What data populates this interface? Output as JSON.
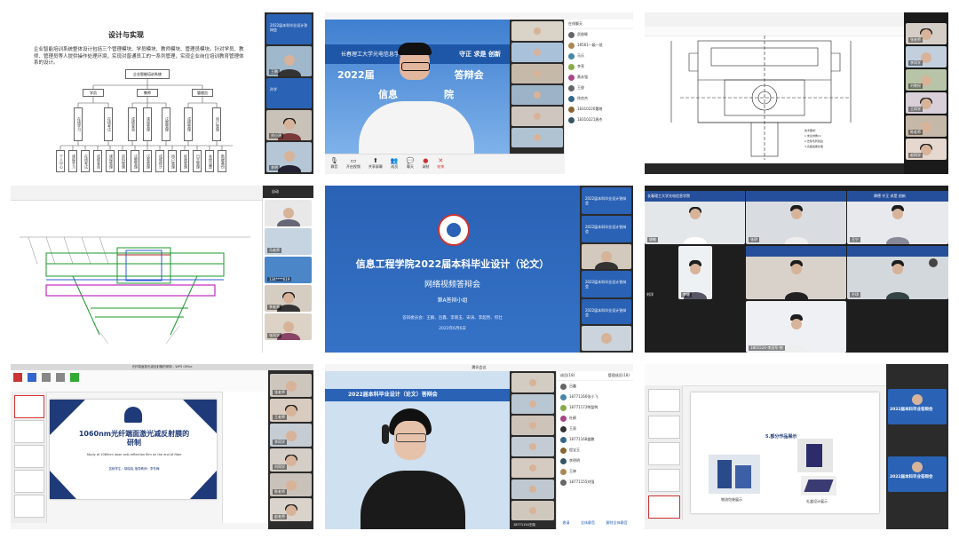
{
  "tile1": {
    "slide_title": "设计与实现",
    "slide_text": "企业智能培训系统整体设计包括三个管理模块、学员模块、教师模块、管理员模块。针对学员、教师、管理员等人提供操作处理环境，实现对普通员工的一系列管理，实现企业岗位培训教育管理体系的设计。",
    "root": "企业智能培训系统",
    "modules": [
      "学员",
      "教师",
      "管理员"
    ],
    "subs": [
      "在线学习",
      "在线考试",
      "成绩查询",
      "课程管理",
      "试题管理",
      "成绩管理",
      "用户管理",
      "系统维护"
    ],
    "leaves": [
      "个人中心",
      "课程学习",
      "在线考试",
      "成绩查询",
      "课程管理",
      "资料管理",
      "试题管理",
      "试卷管理",
      "成绩统计",
      "用户管理",
      "权限管理",
      "日志管理",
      "系统设置",
      "数据备份"
    ],
    "participants": [
      "2022届本科毕业设计答辩会",
      "王鹏",
      "孙学",
      "刘小涵",
      "李明",
      "张伟"
    ]
  },
  "tile2": {
    "banner_text": "守正 求是 创新",
    "school": "长春理工大学光电信息学院",
    "title": "2022届",
    "title_suffix": "答辩会",
    "sub": "信息",
    "sub_tail": "院",
    "chat_header": "在线聊天",
    "chat_items": [
      "武俊辉",
      "18561一级一班",
      "马乐",
      "李亮",
      "黄永强",
      "王俊",
      "徐良杰",
      "18310226董晓",
      "18310221周杰"
    ],
    "toolbar": [
      "静音",
      "开启视频",
      "共享屏幕",
      "成员",
      "聊天",
      "录制",
      "结束"
    ]
  },
  "tile3": {
    "participants": [
      "张老师",
      "李同学",
      "刘教授",
      "王同学",
      "陈老师",
      "赵同学"
    ]
  },
  "tile4": {
    "participants": [
      "自动",
      "马老师",
      "134****619",
      "李老师",
      "张同学"
    ]
  },
  "tile5": {
    "title": "信息工程学院2022届本科毕业设计（论文）",
    "subtitle": "网络视频答辩会",
    "group": "第A答辩小组",
    "committee": "答辩委员会：王鹏、吕鑫、李南玉、宋涛、李超然、何壮",
    "date": "2022年6月6日",
    "side_cards": [
      "2022届本科毕业设计答辩会",
      "2022届本科毕业设计答辩会",
      "2022届本科毕业设计答辩会",
      "2022届本科毕业设计答辩会"
    ]
  },
  "tile6": {
    "banner": "长春理工大学光电信息学院",
    "motto": "厚德 守正 求是 创新",
    "names": [
      "姚敏",
      "张玥",
      "王宁",
      "李健",
      "刘洋",
      "孙琪",
      "1801524-李冠军-物"
    ]
  },
  "tile7": {
    "window_title": "光纤端面激光减反射膜的研制 - WPS Office",
    "cover_title_cn": "1060nm光纤端面激光减反射膜的研制",
    "cover_title_en": "Study of 1060nm laser anti-reflection film on the end of fiber",
    "author_line": "答辩学生：胡晓晓  指导教师：李冬梅",
    "participants": [
      "张老师",
      "王老师",
      "李同学",
      "刘同学",
      "陈老师",
      "赵老师"
    ]
  },
  "tile8": {
    "window_title": "腾讯会议",
    "banner": "2022届本科毕业设计（论文）答辩会",
    "member_header": "成员(18)",
    "manage": "管理成员(18)",
    "members": [
      "吕鑫",
      "18771166张小飞",
      "18771172鸭梨鸭",
      "杜鹃",
      "王雨",
      "18771168姜鹏",
      "程宝玉",
      "李明明",
      "王婷",
      "18771155刘强"
    ],
    "invite": "邀请",
    "mute_all": "全体静音",
    "unmute_all": "解除全体静音",
    "footer_name": "18771154王晓"
  },
  "tile9": {
    "slide_title": "5.部分作品展示",
    "caption1": "物流包装展示",
    "caption2": "礼盒设计展示",
    "side_cards": [
      "2022届本科毕业答辩会",
      "2022届本科毕业答辩会"
    ]
  },
  "colors": {
    "meeting_blue": "#2a62b5",
    "dark_panel": "#2b2b2b",
    "slide_navy": "#1f3a78"
  }
}
